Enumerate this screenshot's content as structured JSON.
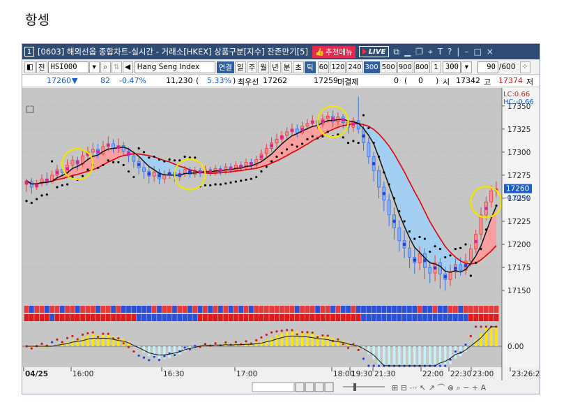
{
  "page_heading": "항셍",
  "window": {
    "index": "1",
    "title": "[0603] 해외선옵 종합차트-실시간 - 거래소[HKEX] 상품구분[지수] 잔존만기[5]",
    "recommend_label": "추천메뉴",
    "live_label": "LIVE"
  },
  "toolbar": {
    "jeon_label": "전",
    "symbol_code": "HSI000",
    "symbol_name": "Hang Seng Index",
    "link_label": "연결",
    "period_buttons": [
      "일",
      "주",
      "월",
      "년",
      "분",
      "초",
      "틱"
    ],
    "active_period": "틱",
    "tick_buttons": [
      "60",
      "120",
      "240",
      "300",
      "500",
      "900",
      "800",
      "1"
    ],
    "active_tick": "300",
    "tick_value": "300",
    "count_value": "90",
    "count_total": "/600"
  },
  "quote": {
    "price": "17260",
    "direction": "▼",
    "change": "82",
    "change_pct": "-0.47%",
    "volume": "11,230",
    "vol_paren_open": "(",
    "vol_pct": "5.33%",
    "vol_paren_close": ")",
    "best_bid_label": "최우선",
    "best_bid": "17262",
    "best_ask": "17259",
    "open_interest_label": "미결제",
    "oi_value": "0",
    "oi_paren_open": "(",
    "oi_change": "0",
    "oi_paren_close": ")",
    "open_label": "시",
    "open_value": "17342",
    "high_label": "고",
    "high_value": "17374",
    "low_label": "저"
  },
  "chart_data": {
    "type": "candlestick",
    "y_axis_ticks": [
      "17350",
      "17325",
      "17300",
      "17275",
      "17250",
      "17225",
      "17200",
      "17175",
      "17150"
    ],
    "ylim": [
      17138,
      17368
    ],
    "current_price_label": "17260",
    "current_change_label": "-0.01%",
    "legend": [
      "LC:0.66",
      "HC:-0.66"
    ],
    "indicator_axis_label": "0.00",
    "time_labels": [
      "04/25",
      "16:00",
      "16:30",
      "17:00",
      "18:00",
      "19:30",
      "21:30",
      "22:00",
      "22:30",
      "23:00",
      "23:26:2"
    ],
    "candles": [
      [
        17265,
        17269,
        17257,
        17271
      ],
      [
        17268,
        17262,
        17255,
        17272
      ],
      [
        17262,
        17266,
        17259,
        17270
      ],
      [
        17266,
        17271,
        17263,
        17276
      ],
      [
        17271,
        17268,
        17264,
        17278
      ],
      [
        17268,
        17275,
        17266,
        17280
      ],
      [
        17275,
        17281,
        17272,
        17286
      ],
      [
        17281,
        17278,
        17274,
        17288
      ],
      [
        17278,
        17286,
        17275,
        17292
      ],
      [
        17286,
        17291,
        17283,
        17296
      ],
      [
        17291,
        17287,
        17280,
        17295
      ],
      [
        17287,
        17296,
        17284,
        17301
      ],
      [
        17296,
        17300,
        17291,
        17306
      ],
      [
        17300,
        17303,
        17296,
        17310
      ],
      [
        17303,
        17298,
        17293,
        17309
      ],
      [
        17298,
        17306,
        17296,
        17312
      ],
      [
        17306,
        17309,
        17301,
        17317
      ],
      [
        17309,
        17304,
        17299,
        17314
      ],
      [
        17304,
        17307,
        17299,
        17315
      ],
      [
        17307,
        17301,
        17296,
        17311
      ],
      [
        17301,
        17296,
        17289,
        17305
      ],
      [
        17296,
        17290,
        17283,
        17299
      ],
      [
        17290,
        17283,
        17276,
        17294
      ],
      [
        17283,
        17279,
        17271,
        17290
      ],
      [
        17279,
        17274,
        17266,
        17284
      ],
      [
        17274,
        17278,
        17268,
        17285
      ],
      [
        17278,
        17271,
        17265,
        17282
      ],
      [
        17271,
        17275,
        17266,
        17280
      ],
      [
        17275,
        17278,
        17271,
        17282
      ],
      [
        17278,
        17273,
        17268,
        17281
      ],
      [
        17273,
        17277,
        17269,
        17281
      ],
      [
        17277,
        17281,
        17273,
        17285
      ],
      [
        17281,
        17276,
        17272,
        17284
      ],
      [
        17276,
        17280,
        17272,
        17284
      ],
      [
        17280,
        17277,
        17273,
        17283
      ],
      [
        17277,
        17281,
        17274,
        17285
      ],
      [
        17281,
        17278,
        17274,
        17284
      ],
      [
        17278,
        17282,
        17275,
        17286
      ],
      [
        17282,
        17279,
        17275,
        17285
      ],
      [
        17279,
        17284,
        17276,
        17288
      ],
      [
        17284,
        17281,
        17277,
        17288
      ],
      [
        17281,
        17286,
        17278,
        17290
      ],
      [
        17286,
        17283,
        17279,
        17290
      ],
      [
        17283,
        17289,
        17280,
        17293
      ],
      [
        17289,
        17286,
        17281,
        17293
      ],
      [
        17286,
        17292,
        17283,
        17296
      ],
      [
        17292,
        17298,
        17289,
        17303
      ],
      [
        17298,
        17304,
        17294,
        17309
      ],
      [
        17304,
        17310,
        17300,
        17316
      ],
      [
        17310,
        17314,
        17305,
        17320
      ],
      [
        17314,
        17318,
        17309,
        17323
      ],
      [
        17318,
        17322,
        17313,
        17327
      ],
      [
        17322,
        17325,
        17318,
        17331
      ],
      [
        17325,
        17321,
        17316,
        17330
      ],
      [
        17321,
        17328,
        17319,
        17333
      ],
      [
        17328,
        17331,
        17324,
        17336
      ],
      [
        17331,
        17334,
        17327,
        17340
      ],
      [
        17334,
        17330,
        17325,
        17338
      ],
      [
        17330,
        17336,
        17327,
        17341
      ],
      [
        17336,
        17339,
        17332,
        17344
      ],
      [
        17339,
        17333,
        17327,
        17345
      ],
      [
        17333,
        17338,
        17329,
        17343
      ],
      [
        17338,
        17332,
        17326,
        17341
      ],
      [
        17332,
        17327,
        17320,
        17336
      ],
      [
        17327,
        17334,
        17322,
        17338
      ],
      [
        17334,
        17325,
        17320,
        17360
      ],
      [
        17325,
        17310,
        17302,
        17330
      ],
      [
        17310,
        17295,
        17287,
        17316
      ],
      [
        17295,
        17280,
        17268,
        17300
      ],
      [
        17280,
        17262,
        17250,
        17285
      ],
      [
        17262,
        17248,
        17236,
        17268
      ],
      [
        17248,
        17232,
        17220,
        17255
      ],
      [
        17232,
        17218,
        17205,
        17240
      ],
      [
        17218,
        17204,
        17192,
        17226
      ],
      [
        17204,
        17196,
        17185,
        17215
      ],
      [
        17196,
        17186,
        17174,
        17204
      ],
      [
        17186,
        17180,
        17168,
        17196
      ],
      [
        17180,
        17190,
        17172,
        17198
      ],
      [
        17190,
        17175,
        17162,
        17196
      ],
      [
        17175,
        17169,
        17158,
        17182
      ],
      [
        17169,
        17180,
        17160,
        17188
      ],
      [
        17180,
        17168,
        17152,
        17185
      ],
      [
        17168,
        17162,
        17150,
        17176
      ],
      [
        17162,
        17170,
        17155,
        17178
      ],
      [
        17170,
        17178,
        17163,
        17185
      ],
      [
        17178,
        17172,
        17166,
        17186
      ],
      [
        17172,
        17182,
        17167,
        17190
      ],
      [
        17182,
        17195,
        17176,
        17200
      ],
      [
        17195,
        17211,
        17190,
        17216
      ],
      [
        17211,
        17232,
        17205,
        17240
      ],
      [
        17232,
        17246,
        17226,
        17252
      ],
      [
        17246,
        17258,
        17240,
        17264
      ],
      [
        17258,
        17260,
        17252,
        17268
      ]
    ]
  }
}
